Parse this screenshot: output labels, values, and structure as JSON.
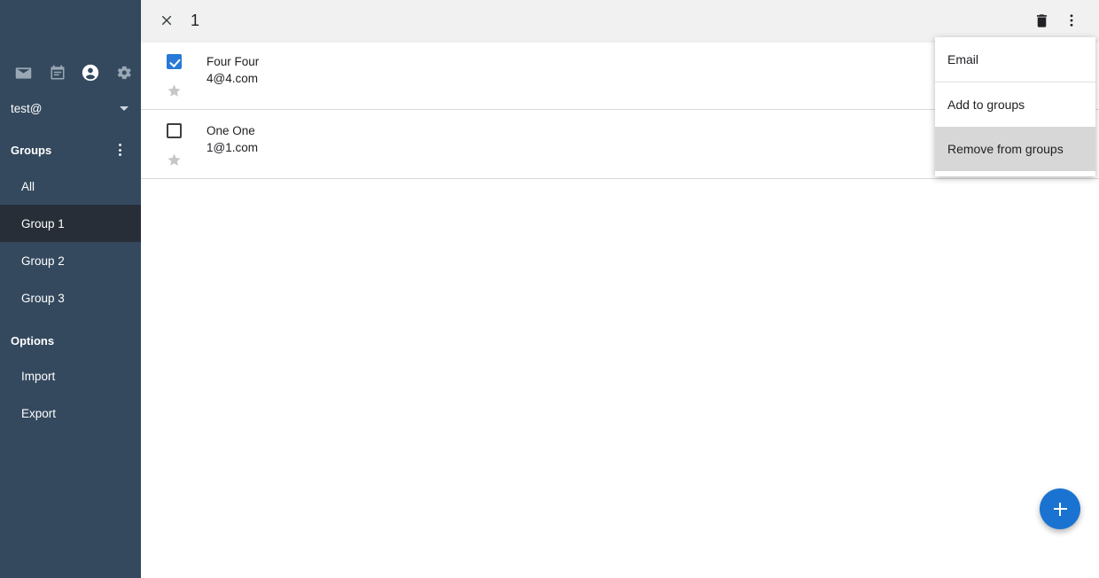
{
  "sidebar": {
    "app_icons": [
      {
        "name": "mail-icon",
        "label": "Mail",
        "active": false
      },
      {
        "name": "calendar-icon",
        "label": "Calendar",
        "active": false
      },
      {
        "name": "contacts-icon",
        "label": "Contacts",
        "active": true
      },
      {
        "name": "settings-icon",
        "label": "Settings",
        "active": false
      }
    ],
    "account": "test@",
    "groups_section_label": "Groups",
    "groups": [
      {
        "label": "All",
        "active": false
      },
      {
        "label": "Group 1",
        "active": true
      },
      {
        "label": "Group 2",
        "active": false
      },
      {
        "label": "Group 3",
        "active": false
      }
    ],
    "options_section_label": "Options",
    "options": [
      {
        "label": "Import"
      },
      {
        "label": "Export"
      }
    ],
    "colors": {
      "background": "#34495e",
      "active_item": "#272e38",
      "text": "#ffffff",
      "icon_dim": "#9aa7b4"
    }
  },
  "topbar": {
    "close_label": "✕",
    "title": "1",
    "delete_label": "Delete",
    "more_label": "More options",
    "background": "#f1f1f1"
  },
  "contacts": {
    "rows": [
      {
        "name": "Four Four",
        "email": "4@4.com",
        "checked": true,
        "starred": false
      },
      {
        "name": "One One",
        "email": "1@1.com",
        "checked": false,
        "starred": false
      }
    ],
    "checkbox_color": "#2979d6",
    "star_color": "#c6c6c6"
  },
  "context_menu": {
    "items": [
      {
        "label": "Email",
        "hovered": false,
        "divider_after": true
      },
      {
        "label": "Add to groups",
        "hovered": false,
        "divider_after": false
      },
      {
        "label": "Remove from groups",
        "hovered": true,
        "divider_after": false
      }
    ],
    "hover_color": "#d7d7d7"
  },
  "fab": {
    "label": "+",
    "color": "#1a73d1"
  }
}
